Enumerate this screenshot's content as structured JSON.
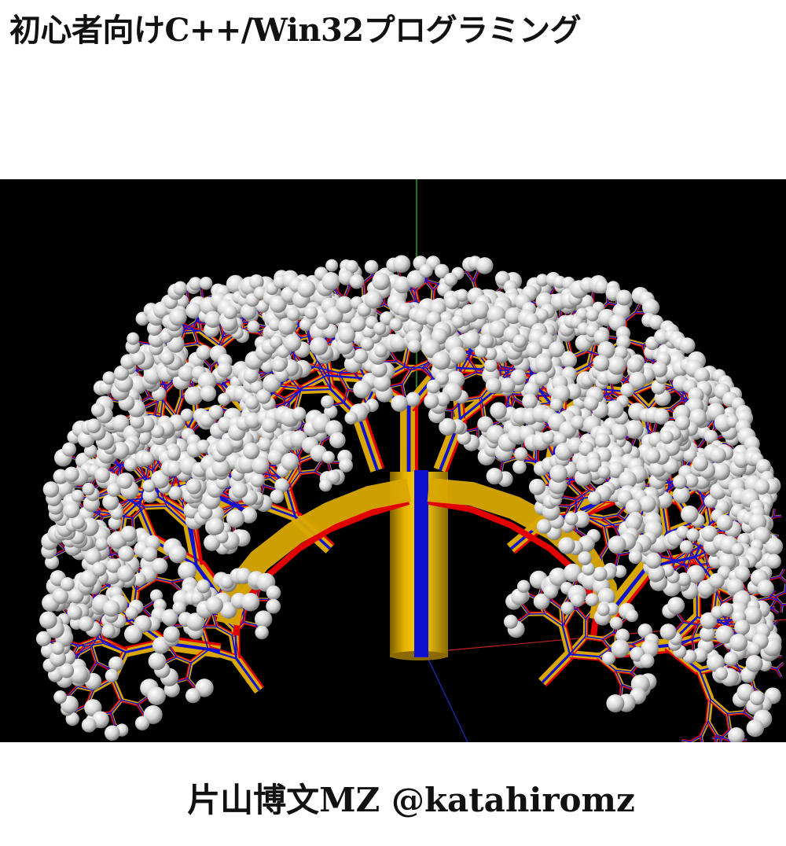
{
  "cover": {
    "title": "初心者向けC++/Win32プログラミング",
    "author": "片山博文MZ @katahiromz"
  },
  "colors": {
    "background": "#000000",
    "trunk_gold": "#d9a800",
    "trunk_red": "#e00000",
    "trunk_blue": "#1010d0",
    "leaf_white": "#e8e8e8",
    "axis_green": "#30c030",
    "axis_red": "#c02020",
    "axis_blue": "#2030c0"
  }
}
